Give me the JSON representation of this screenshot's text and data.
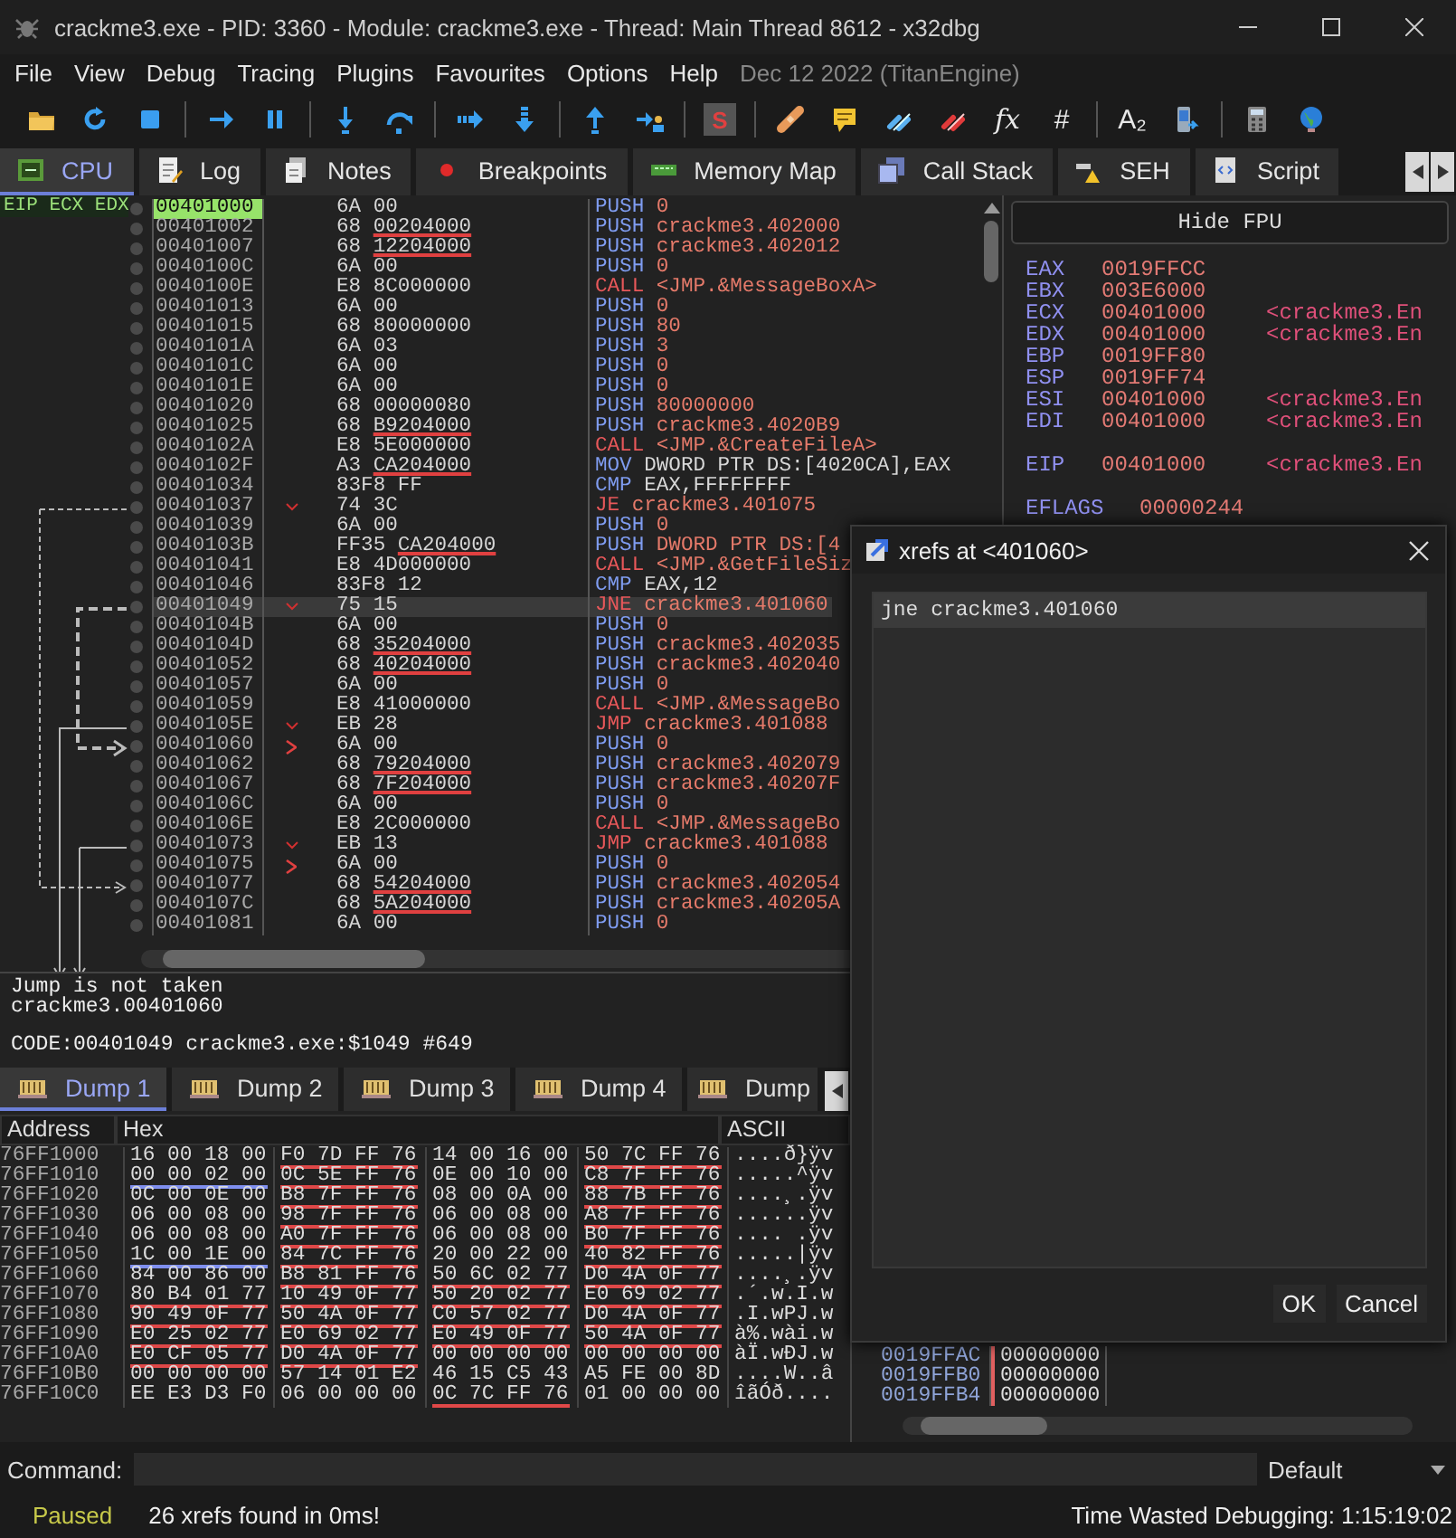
{
  "window": {
    "title": "crackme3.exe - PID: 3360 - Module: crackme3.exe - Thread: Main Thread 8612 - x32dbg"
  },
  "menu": {
    "items": [
      "File",
      "View",
      "Debug",
      "Tracing",
      "Plugins",
      "Favourites",
      "Options",
      "Help"
    ],
    "build": "Dec 12 2022 (TitanEngine)"
  },
  "toolbar": [
    {
      "kind": "icon"
    },
    {
      "kind": "icon"
    },
    {
      "kind": "icon"
    },
    {
      "kind": "separator"
    },
    {
      "kind": "icon"
    },
    {
      "kind": "icon"
    },
    {
      "kind": "separator"
    },
    {
      "kind": "icon"
    },
    {
      "kind": "icon"
    },
    {
      "kind": "separator"
    },
    {
      "kind": "icon"
    },
    {
      "kind": "icon"
    },
    {
      "kind": "separator"
    },
    {
      "kind": "icon"
    },
    {
      "kind": "icon"
    },
    {
      "kind": "separator"
    },
    {
      "kind": "badge",
      "label": "S"
    },
    {
      "kind": "separator"
    },
    {
      "kind": "icon"
    },
    {
      "kind": "icon"
    },
    {
      "kind": "icon"
    },
    {
      "kind": "icon"
    },
    {
      "kind": "italic",
      "label": "fx"
    },
    {
      "kind": "text",
      "label": "#"
    },
    {
      "kind": "separator"
    },
    {
      "kind": "text",
      "label": "A₂"
    },
    {
      "kind": "icon"
    },
    {
      "kind": "separator"
    },
    {
      "kind": "icon"
    },
    {
      "kind": "icon"
    }
  ],
  "tabs": [
    {
      "label": "CPU",
      "selected": true
    },
    {
      "label": "Log",
      "selected": false
    },
    {
      "label": "Notes",
      "selected": false
    },
    {
      "label": "Breakpoints",
      "selected": false
    },
    {
      "label": "Memory Map",
      "selected": false
    },
    {
      "label": "Call Stack",
      "selected": false
    },
    {
      "label": "SEH",
      "selected": false
    },
    {
      "label": "Script",
      "selected": false
    }
  ],
  "disassembly": {
    "register_labels": "EIP ECX EDX",
    "rows": [
      {
        "address": "00401000",
        "bytes": "6A 00",
        "mnemonic": "PUSH",
        "operand": "0",
        "kind": "push",
        "selected": false,
        "current": true
      },
      {
        "address": "00401002",
        "bytes": "68",
        "operand_bytes": "00204000",
        "underlined": true,
        "mnemonic": "PUSH",
        "operand": "crackme3.402000",
        "kind": "push",
        "selected": false,
        "current": false
      },
      {
        "address": "00401007",
        "bytes": "68",
        "operand_bytes": "12204000",
        "underlined": true,
        "mnemonic": "PUSH",
        "operand": "crackme3.402012",
        "kind": "push",
        "selected": false,
        "current": false
      },
      {
        "address": "0040100C",
        "bytes": "6A 00",
        "mnemonic": "PUSH",
        "operand": "0",
        "kind": "push",
        "selected": false,
        "current": false
      },
      {
        "address": "0040100E",
        "bytes": "E8 8C000000",
        "mnemonic": "CALL",
        "operand": "<JMP.&MessageBoxA>",
        "kind": "call",
        "selected": false,
        "current": false
      },
      {
        "address": "00401013",
        "bytes": "6A 00",
        "mnemonic": "PUSH",
        "operand": "0",
        "kind": "push",
        "selected": false,
        "current": false
      },
      {
        "address": "00401015",
        "bytes": "68 80000000",
        "mnemonic": "PUSH",
        "operand": "80",
        "kind": "push",
        "selected": false,
        "current": false
      },
      {
        "address": "0040101A",
        "bytes": "6A 03",
        "mnemonic": "PUSH",
        "operand": "3",
        "kind": "push",
        "selected": false,
        "current": false
      },
      {
        "address": "0040101C",
        "bytes": "6A 00",
        "mnemonic": "PUSH",
        "operand": "0",
        "kind": "push",
        "selected": false,
        "current": false
      },
      {
        "address": "0040101E",
        "bytes": "6A 00",
        "mnemonic": "PUSH",
        "operand": "0",
        "kind": "push",
        "selected": false,
        "current": false
      },
      {
        "address": "00401020",
        "bytes": "68",
        "operand_bytes": "00000080",
        "underlined": false,
        "mnemonic": "PUSH",
        "operand": "80000000",
        "kind": "push",
        "selected": false,
        "current": false
      },
      {
        "address": "00401025",
        "bytes": "68",
        "operand_bytes": "B9204000",
        "underlined": true,
        "mnemonic": "PUSH",
        "operand": "crackme3.4020B9",
        "kind": "push",
        "selected": false,
        "current": false
      },
      {
        "address": "0040102A",
        "bytes": "E8 5E000000",
        "mnemonic": "CALL",
        "operand": "<JMP.&CreateFileA>",
        "kind": "call",
        "selected": false,
        "current": false
      },
      {
        "address": "0040102F",
        "bytes": "A3",
        "operand_bytes": "CA204000",
        "underlined": true,
        "mnemonic": "MOV",
        "operand": "DWORD PTR DS:[4020CA],EAX",
        "kind": "move",
        "selected": false,
        "current": false
      },
      {
        "address": "00401034",
        "bytes": "83F8 FF",
        "mnemonic": "CMP",
        "operand": "EAX,FFFFFFFF",
        "kind": "compare",
        "selected": false,
        "current": false
      },
      {
        "address": "00401037",
        "bytes": "74 3C",
        "mnemonic": "JE",
        "operand": "crackme3.401075",
        "kind": "jump",
        "jump_mark": true,
        "selected": false,
        "current": false
      },
      {
        "address": "00401039",
        "bytes": "6A 00",
        "mnemonic": "PUSH",
        "operand": "0",
        "kind": "push",
        "selected": false,
        "current": false
      },
      {
        "address": "0040103B",
        "bytes": "FF35",
        "operand_bytes": "CA204000",
        "underlined": true,
        "mnemonic": "PUSH",
        "operand": "DWORD PTR DS:[4",
        "kind": "push",
        "selected": false,
        "current": false
      },
      {
        "address": "00401041",
        "bytes": "E8 4D000000",
        "mnemonic": "CALL",
        "operand": "<JMP.&GetFileSiz",
        "kind": "call",
        "selected": false,
        "current": false
      },
      {
        "address": "00401046",
        "bytes": "83F8 12",
        "mnemonic": "CMP",
        "operand": "EAX,12",
        "kind": "compare",
        "selected": false,
        "current": false
      },
      {
        "address": "00401049",
        "bytes": "75 15",
        "mnemonic": "JNE",
        "operand": "crackme3.401060",
        "kind": "jump",
        "jump_mark": true,
        "selected": true,
        "current": false
      },
      {
        "address": "0040104B",
        "bytes": "6A 00",
        "mnemonic": "PUSH",
        "operand": "0",
        "kind": "push",
        "selected": false,
        "current": false
      },
      {
        "address": "0040104D",
        "bytes": "68",
        "operand_bytes": "35204000",
        "underlined": true,
        "mnemonic": "PUSH",
        "operand": "crackme3.402035",
        "kind": "push",
        "selected": false,
        "current": false
      },
      {
        "address": "00401052",
        "bytes": "68",
        "operand_bytes": "40204000",
        "underlined": true,
        "mnemonic": "PUSH",
        "operand": "crackme3.402040",
        "kind": "push",
        "selected": false,
        "current": false
      },
      {
        "address": "00401057",
        "bytes": "6A 00",
        "mnemonic": "PUSH",
        "operand": "0",
        "kind": "push",
        "selected": false,
        "current": false
      },
      {
        "address": "00401059",
        "bytes": "E8 41000000",
        "mnemonic": "CALL",
        "operand": "<JMP.&MessageBo",
        "kind": "call",
        "selected": false,
        "current": false
      },
      {
        "address": "0040105E",
        "bytes": "EB 28",
        "mnemonic": "JMP",
        "operand": "crackme3.401088",
        "kind": "jump",
        "jump_mark": true,
        "selected": false,
        "current": false
      },
      {
        "address": "00401060",
        "bytes": "6A 00",
        "mnemonic": "PUSH",
        "operand": "0",
        "kind": "push",
        "target_mark": true,
        "selected": false,
        "current": false
      },
      {
        "address": "00401062",
        "bytes": "68",
        "operand_bytes": "79204000",
        "underlined": true,
        "mnemonic": "PUSH",
        "operand": "crackme3.402079",
        "kind": "push",
        "selected": false,
        "current": false
      },
      {
        "address": "00401067",
        "bytes": "68",
        "operand_bytes": "7F204000",
        "underlined": true,
        "mnemonic": "PUSH",
        "operand": "crackme3.40207F",
        "kind": "push",
        "selected": false,
        "current": false
      },
      {
        "address": "0040106C",
        "bytes": "6A 00",
        "mnemonic": "PUSH",
        "operand": "0",
        "kind": "push",
        "selected": false,
        "current": false
      },
      {
        "address": "0040106E",
        "bytes": "E8 2C000000",
        "mnemonic": "CALL",
        "operand": "<JMP.&MessageBo",
        "kind": "call",
        "selected": false,
        "current": false
      },
      {
        "address": "00401073",
        "bytes": "EB 13",
        "mnemonic": "JMP",
        "operand": "crackme3.401088",
        "kind": "jump",
        "jump_mark": true,
        "selected": false,
        "current": false
      },
      {
        "address": "00401075",
        "bytes": "6A 00",
        "mnemonic": "PUSH",
        "operand": "0",
        "kind": "push",
        "target_mark": true,
        "selected": false,
        "current": false
      },
      {
        "address": "00401077",
        "bytes": "68",
        "operand_bytes": "54204000",
        "underlined": true,
        "mnemonic": "PUSH",
        "operand": "crackme3.402054",
        "kind": "push",
        "selected": false,
        "current": false
      },
      {
        "address": "0040107C",
        "bytes": "68",
        "operand_bytes": "5A204000",
        "underlined": true,
        "mnemonic": "PUSH",
        "operand": "crackme3.40205A",
        "kind": "push",
        "selected": false,
        "current": false
      },
      {
        "address": "00401081",
        "bytes": "6A 00",
        "mnemonic": "PUSH",
        "operand": "0",
        "kind": "push",
        "selected": false,
        "current": false
      }
    ]
  },
  "registers": {
    "toggle": "Hide FPU",
    "groups": [
      [
        {
          "name": "EAX",
          "value": "0019FFCC"
        },
        {
          "name": "EBX",
          "value": "003E6000"
        },
        {
          "name": "ECX",
          "value": "00401000",
          "comment": "<crackme3.En"
        },
        {
          "name": "EDX",
          "value": "00401000",
          "comment": "<crackme3.En"
        },
        {
          "name": "EBP",
          "value": "0019FF80"
        },
        {
          "name": "ESP",
          "value": "0019FF74"
        },
        {
          "name": "ESI",
          "value": "00401000",
          "comment": "<crackme3.En"
        },
        {
          "name": "EDI",
          "value": "00401000",
          "comment": "<crackme3.En"
        }
      ],
      [
        {
          "name": "EIP",
          "value": "00401000",
          "comment": "<crackme3.En"
        }
      ],
      [
        {
          "name": "EFLAGS",
          "value": "00000244"
        }
      ]
    ]
  },
  "info": [
    "Jump is not taken",
    "crackme3.00401060",
    "CODE:00401049 crackme3.exe:$1049 #649"
  ],
  "dump_tabs": [
    {
      "label": "Dump 1",
      "selected": true
    },
    {
      "label": "Dump 2",
      "selected": false
    },
    {
      "label": "Dump 3",
      "selected": false
    },
    {
      "label": "Dump 4",
      "selected": false
    },
    {
      "label": "Dump",
      "selected": false
    }
  ],
  "dump": {
    "columns": [
      "Address",
      "Hex",
      "ASCII"
    ],
    "rows": [
      {
        "address": "76FF1000",
        "groups": [
          {
            "hex": "16 00 18 00"
          },
          {
            "hex": "F0 7D FF 76",
            "color": "#e04848"
          },
          {
            "hex": "14 00 16 00"
          },
          {
            "hex": "50 7C FF 76",
            "color": "#e04848"
          }
        ],
        "ascii": "....ð}ÿv"
      },
      {
        "address": "76FF1010",
        "groups": [
          {
            "hex": "00 00 02 00",
            "color": "#7f8fef"
          },
          {
            "hex": "0C 5E FF 76",
            "color": "#e04848"
          },
          {
            "hex": "0E 00 10 00"
          },
          {
            "hex": "C8 7F FF 76",
            "color": "#e04848"
          }
        ],
        "ascii": ".....^ÿv"
      },
      {
        "address": "76FF1020",
        "groups": [
          {
            "hex": "0C 00 0E 00"
          },
          {
            "hex": "B8 7F FF 76",
            "color": "#e04848"
          },
          {
            "hex": "08 00 0A 00"
          },
          {
            "hex": "88 7B FF 76",
            "color": "#e04848"
          }
        ],
        "ascii": "....¸.ÿv"
      },
      {
        "address": "76FF1030",
        "groups": [
          {
            "hex": "06 00 08 00"
          },
          {
            "hex": "98 7F FF 76",
            "color": "#e04848"
          },
          {
            "hex": "06 00 08 00"
          },
          {
            "hex": "A8 7F FF 76",
            "color": "#e04848"
          }
        ],
        "ascii": "......ÿv"
      },
      {
        "address": "76FF1040",
        "groups": [
          {
            "hex": "06 00 08 00"
          },
          {
            "hex": "A0 7F FF 76",
            "color": "#e04848"
          },
          {
            "hex": "06 00 08 00"
          },
          {
            "hex": "B0 7F FF 76",
            "color": "#e04848"
          }
        ],
        "ascii": ".... .ÿv"
      },
      {
        "address": "76FF1050",
        "groups": [
          {
            "hex": "1C 00 1E 00",
            "color": "#7f8fef"
          },
          {
            "hex": "84 7C FF 76",
            "color": "#e04848"
          },
          {
            "hex": "20 00 22 00"
          },
          {
            "hex": "40 82 FF 76",
            "color": "#e04848"
          }
        ],
        "ascii": ".....|ÿv"
      },
      {
        "address": "76FF1060",
        "groups": [
          {
            "hex": "84 00 86 00"
          },
          {
            "hex": "B8 81 FF 76",
            "color": "#e04848"
          },
          {
            "hex": "50 6C 02 77",
            "color": "#e04848"
          },
          {
            "hex": "D0 4A 0F 77",
            "color": "#e04848"
          }
        ],
        "ascii": "....¸.ÿv"
      },
      {
        "address": "76FF1070",
        "groups": [
          {
            "hex": "80 B4 01 77",
            "color": "#e04848"
          },
          {
            "hex": "10 49 0F 77",
            "color": "#e04848"
          },
          {
            "hex": "50 20 02 77",
            "color": "#e04848"
          },
          {
            "hex": "E0 69 02 77",
            "color": "#e04848"
          }
        ],
        "ascii": ".´.w.I.w"
      },
      {
        "address": "76FF1080",
        "groups": [
          {
            "hex": "90 49 0F 77",
            "color": "#e04848"
          },
          {
            "hex": "50 4A 0F 77",
            "color": "#e04848"
          },
          {
            "hex": "C0 57 02 77",
            "color": "#e04848"
          },
          {
            "hex": "D0 4A 0F 77",
            "color": "#e04848"
          }
        ],
        "ascii": ".I.wPJ.w"
      },
      {
        "address": "76FF1090",
        "groups": [
          {
            "hex": "E0 25 02 77",
            "color": "#e04848"
          },
          {
            "hex": "E0 69 02 77",
            "color": "#e04848"
          },
          {
            "hex": "E0 49 0F 77",
            "color": "#e04848"
          },
          {
            "hex": "50 4A 0F 77",
            "color": "#e04848"
          }
        ],
        "ascii": "à%.wài.w"
      },
      {
        "address": "76FF10A0",
        "groups": [
          {
            "hex": "E0 CF 05 77",
            "color": "#e04848"
          },
          {
            "hex": "D0 4A 0F 77",
            "color": "#e04848"
          },
          {
            "hex": "00 00 00 00"
          },
          {
            "hex": "00 00 00 00"
          }
        ],
        "ascii": "àÏ.wÐJ.w"
      },
      {
        "address": "76FF10B0",
        "groups": [
          {
            "hex": "00 00 00 00"
          },
          {
            "hex": "57 14 01 E2"
          },
          {
            "hex": "46 15 C5 43"
          },
          {
            "hex": "A5 FE 00 8D"
          }
        ],
        "ascii": "....W..â"
      },
      {
        "address": "76FF10C0",
        "groups": [
          {
            "hex": "EE E3 D3 F0"
          },
          {
            "hex": "06 00 00 00"
          },
          {
            "hex": "0C 7C FF 76",
            "color": "#e04848"
          },
          {
            "hex": "01 00 00 00"
          }
        ],
        "ascii": "îãÓð...."
      }
    ]
  },
  "stack": [
    {
      "address": "0019FFAC",
      "value": "00000000"
    },
    {
      "address": "0019FFB0",
      "value": "00000000"
    },
    {
      "address": "0019FFB4",
      "value": "00000000"
    }
  ],
  "xrefs_dialog": {
    "title": "xrefs at <401060>",
    "items": [
      {
        "text": "jne crackme3.401060",
        "selected": true
      }
    ],
    "buttons": [
      "OK",
      "Cancel"
    ]
  },
  "command": {
    "label": "Command:",
    "mode": "Default"
  },
  "status_bar": {
    "state": "Paused",
    "message": "26 xrefs found in 0ms!",
    "time": "Time Wasted Debugging: 1:15:19:02"
  }
}
